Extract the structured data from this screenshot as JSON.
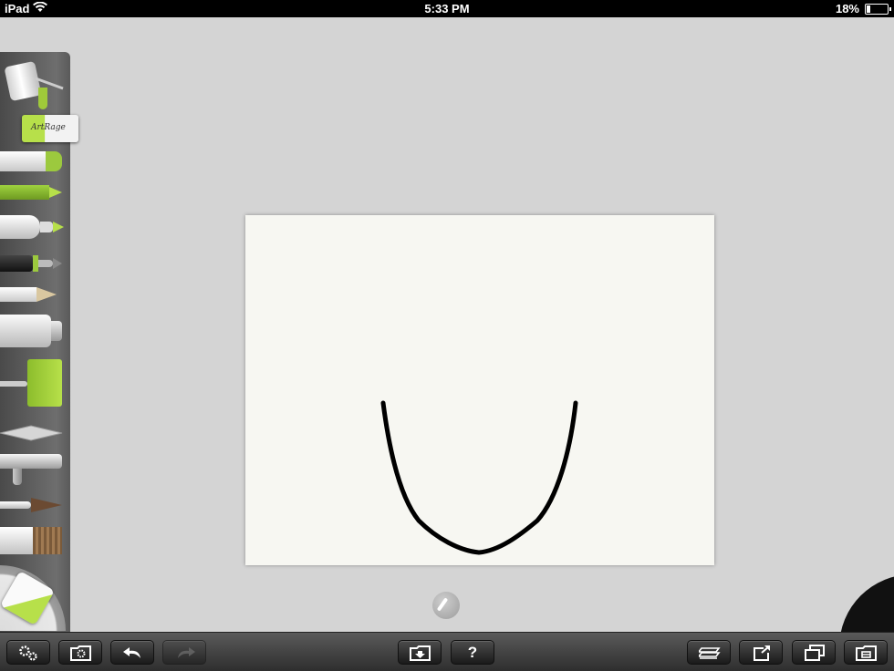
{
  "status_bar": {
    "device": "iPad",
    "time": "5:33 PM",
    "battery_percent": "18%",
    "battery_level": 0.18
  },
  "app": {
    "logo_text": "ArtRage"
  },
  "tools": [
    {
      "name": "paint-pot"
    },
    {
      "name": "marker"
    },
    {
      "name": "crayon"
    },
    {
      "name": "felt-pen"
    },
    {
      "name": "ink-pen"
    },
    {
      "name": "pencil"
    },
    {
      "name": "paint-tube"
    },
    {
      "name": "paint-roller"
    },
    {
      "name": "palette-knife"
    },
    {
      "name": "airbrush"
    },
    {
      "name": "thin-brush"
    },
    {
      "name": "flat-brush"
    },
    {
      "name": "eraser"
    }
  ],
  "toolbar": {
    "help_label": "?"
  },
  "colors": {
    "accent": "#b7e04a",
    "stroke": "#000000",
    "canvas": "#f7f7f2"
  }
}
